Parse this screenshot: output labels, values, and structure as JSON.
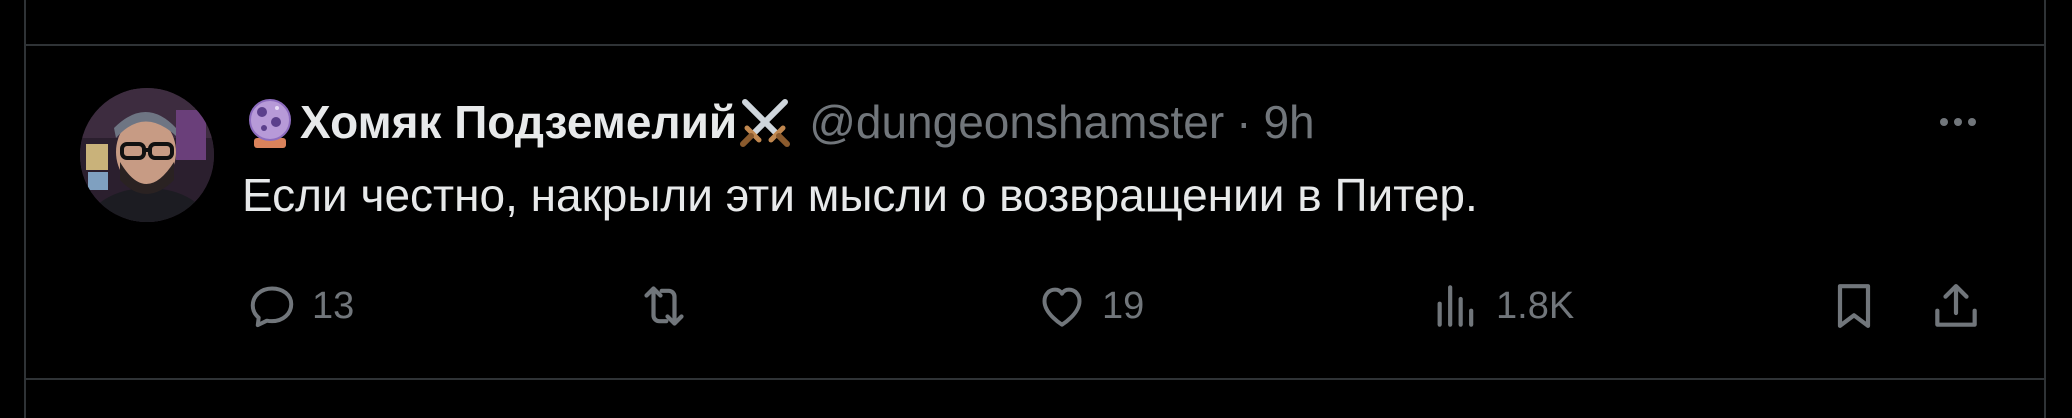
{
  "tweet": {
    "display_name": "Хомяк Подземелий",
    "handle": "@dungeonshamster",
    "separator": "·",
    "time": "9h",
    "text": "Если честно, накрыли эти мысли о возвращении в Питер.",
    "icons": {
      "name_prefix": "crystal-ball-emoji",
      "name_suffix": "crossed-swords-emoji",
      "more": "more-horizontal-icon"
    }
  },
  "actions": {
    "replies": "13",
    "retweets": "",
    "likes": "19",
    "views": "1.8K"
  },
  "colors": {
    "background": "#000000",
    "primary_text": "#e7e9ea",
    "secondary_text": "#71767b",
    "divider": "#2f3336"
  }
}
